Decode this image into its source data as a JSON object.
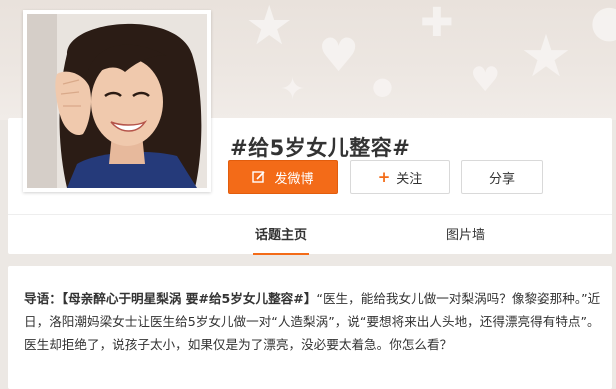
{
  "topic": {
    "title": "#给5岁女儿整容#"
  },
  "buttons": {
    "post_label": "发微博",
    "follow_label": "关注",
    "share_label": "分享"
  },
  "tabs": [
    {
      "label": "话题主页",
      "active": true
    },
    {
      "label": "图片墙",
      "active": false
    }
  ],
  "intro": {
    "lead": "导语：",
    "headline": "【母亲醉心于明星梨涡 要#给5岁女儿整容#】",
    "body": "“医生，能给我女儿做一对梨涡吗？像黎姿那种。”近日，洛阳潮妈梁女士让医生给5岁女儿做一对“人造梨涡”，说“要想将来出人头地，还得漂亮得有特点”。医生却拒绝了，说孩子太小，如果仅是为了漂亮，没必要太着急。你怎么看？"
  },
  "colors": {
    "accent": "#f36b18",
    "banner": "#ece8e4"
  },
  "icons": {
    "post": "edit-icon",
    "follow": "plus-icon"
  }
}
